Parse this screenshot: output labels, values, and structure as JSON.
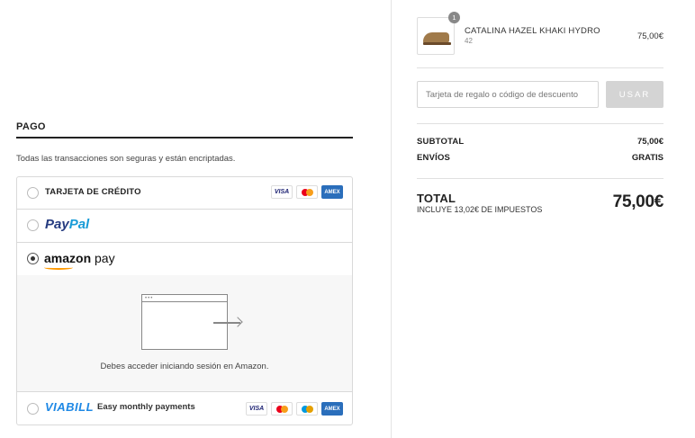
{
  "payment": {
    "section_title": "PAGO",
    "secure_text": "Todas las transacciones son seguras y están encriptadas.",
    "methods": {
      "card": {
        "label": "TARJETA DE CRÉDITO",
        "icons": [
          "visa-icon",
          "mastercard-icon",
          "amex-icon"
        ],
        "visa_text": "VISA",
        "amex_text": "AMEX"
      },
      "paypal": {
        "label_part1": "Pay",
        "label_part2": "Pal"
      },
      "amazon": {
        "label_bold": "amazon",
        "label_rest": " pay",
        "selected": true,
        "message": "Debes acceder iniciando sesión en Amazon."
      },
      "viabill": {
        "logo": "VIABILL",
        "text": "Easy monthly payments",
        "icons": [
          "visa-icon",
          "mastercard-icon",
          "maestro-icon",
          "amex-icon"
        ],
        "visa_text": "VISA",
        "amex_text": "AMEX"
      }
    }
  },
  "order": {
    "item": {
      "quantity": "1",
      "name": "CATALINA HAZEL KHAKI HYDRO",
      "size": "42",
      "price": "75,00€"
    },
    "coupon": {
      "placeholder": "Tarjeta de regalo o código de descuento",
      "button_label": "USAR"
    },
    "subtotal": {
      "label": "SUBTOTAL",
      "value": "75,00€"
    },
    "shipping": {
      "label": "ENVÍOS",
      "value": "GRATIS"
    },
    "total": {
      "label": "TOTAL",
      "sub": "INCLUYE 13,02€ DE IMPUESTOS",
      "value": "75,00€"
    }
  },
  "colors": {
    "paypal_dark": "#253b80",
    "paypal_light": "#179bd7",
    "amazon_orange": "#ff9900",
    "viabill_blue": "#1e88e5",
    "amex_blue": "#2a6ebb"
  }
}
